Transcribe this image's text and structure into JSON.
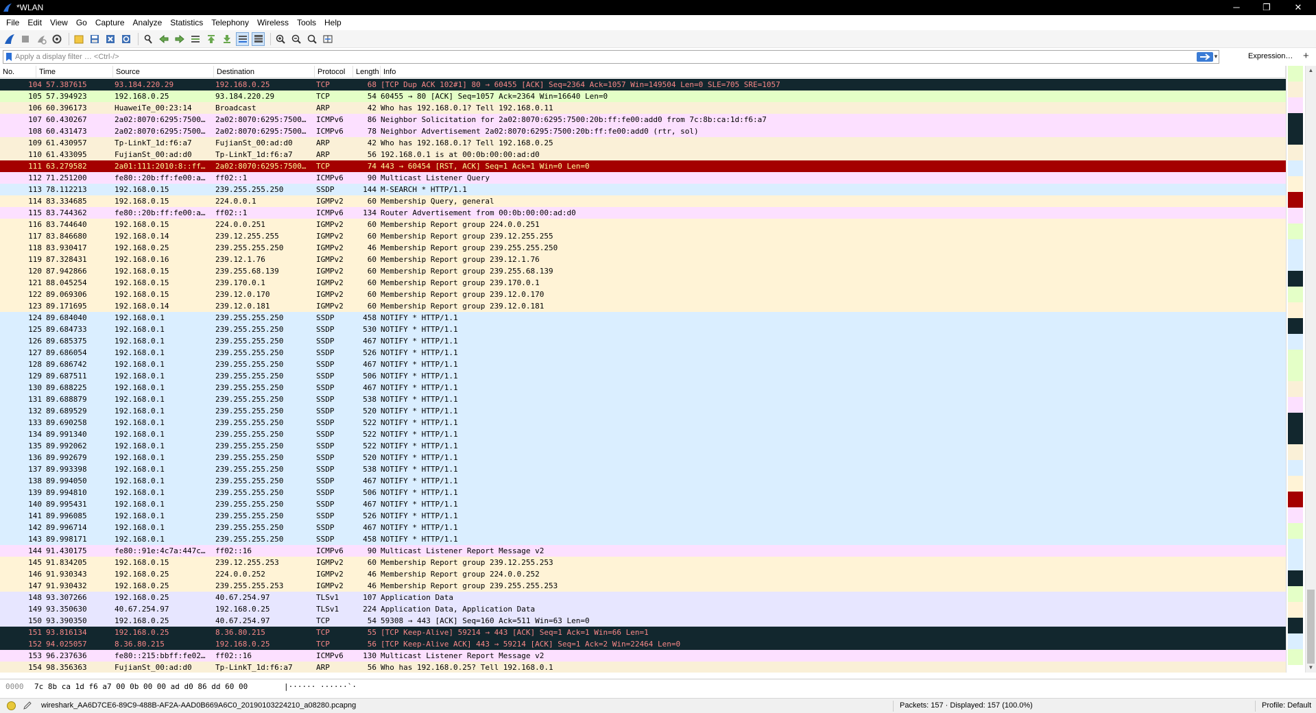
{
  "window": {
    "title": "*WLAN",
    "minimize": "─",
    "maximize": "❐",
    "close": "✕"
  },
  "menu": [
    "File",
    "Edit",
    "View",
    "Go",
    "Capture",
    "Analyze",
    "Statistics",
    "Telephony",
    "Wireless",
    "Tools",
    "Help"
  ],
  "filter": {
    "placeholder": "Apply a display filter … <Ctrl-/>",
    "value": "",
    "expression_label": "Expression…",
    "add_label": "+"
  },
  "columns": [
    "No.",
    "Time",
    "Source",
    "Destination",
    "Protocol",
    "Length",
    "Info"
  ],
  "colors": {
    "tcp": "#e7e6ff",
    "tcp_green": "#e4ffc7",
    "arp": "#faf0d7",
    "icmpv6": "#fce0ff",
    "ssdp_udp": "#daeeff",
    "igmp": "#fff3d6",
    "tls": "#e7e6ff",
    "bad_bg": "#12272e",
    "bad_fg": "#f78787",
    "rst_bg": "#a40000",
    "rst_fg": "#fffc9c",
    "selected": "#cce8ff"
  },
  "packets": [
    {
      "no": "104",
      "time": "57.387615",
      "src": "93.184.220.29",
      "dst": "192.168.0.25",
      "proto": "TCP",
      "len": "68",
      "info": "[TCP Dup ACK 102#1] 80 → 60455 [ACK] Seq=2364 Ack=1057 Win=149504 Len=0 SLE=705 SRE=1057",
      "style": "bad"
    },
    {
      "no": "105",
      "time": "57.394923",
      "src": "192.168.0.25",
      "dst": "93.184.220.29",
      "proto": "TCP",
      "len": "54",
      "info": "60455 → 80 [ACK] Seq=1057 Ack=2364 Win=16640 Len=0",
      "style": "tcp_green"
    },
    {
      "no": "106",
      "time": "60.396173",
      "src": "HuaweiTe_00:23:14",
      "dst": "Broadcast",
      "proto": "ARP",
      "len": "42",
      "info": "Who has 192.168.0.1? Tell 192.168.0.11",
      "style": "arp"
    },
    {
      "no": "107",
      "time": "60.430267",
      "src": "2a02:8070:6295:7500…",
      "dst": "2a02:8070:6295:7500…",
      "proto": "ICMPv6",
      "len": "86",
      "info": "Neighbor Solicitation for 2a02:8070:6295:7500:20b:ff:fe00:add0 from 7c:8b:ca:1d:f6:a7",
      "style": "icmpv6"
    },
    {
      "no": "108",
      "time": "60.431473",
      "src": "2a02:8070:6295:7500…",
      "dst": "2a02:8070:6295:7500…",
      "proto": "ICMPv6",
      "len": "78",
      "info": "Neighbor Advertisement 2a02:8070:6295:7500:20b:ff:fe00:add0 (rtr, sol)",
      "style": "icmpv6"
    },
    {
      "no": "109",
      "time": "61.430957",
      "src": "Tp-LinkT_1d:f6:a7",
      "dst": "FujianSt_00:ad:d0",
      "proto": "ARP",
      "len": "42",
      "info": "Who has 192.168.0.1? Tell 192.168.0.25",
      "style": "arp"
    },
    {
      "no": "110",
      "time": "61.433095",
      "src": "FujianSt_00:ad:d0",
      "dst": "Tp-LinkT_1d:f6:a7",
      "proto": "ARP",
      "len": "56",
      "info": "192.168.0.1 is at 00:0b:00:00:ad:d0",
      "style": "arp"
    },
    {
      "no": "111",
      "time": "63.279582",
      "src": "2a01:111:2010:8::ff…",
      "dst": "2a02:8070:6295:7500…",
      "proto": "TCP",
      "len": "74",
      "info": "443 → 60454 [RST, ACK] Seq=1 Ack=1 Win=0 Len=0",
      "style": "rst"
    },
    {
      "no": "112",
      "time": "71.251200",
      "src": "fe80::20b:ff:fe00:a…",
      "dst": "ff02::1",
      "proto": "ICMPv6",
      "len": "90",
      "info": "Multicast Listener Query",
      "style": "icmpv6"
    },
    {
      "no": "113",
      "time": "78.112213",
      "src": "192.168.0.15",
      "dst": "239.255.255.250",
      "proto": "SSDP",
      "len": "144",
      "info": "M-SEARCH * HTTP/1.1",
      "style": "ssdp_udp"
    },
    {
      "no": "114",
      "time": "83.334685",
      "src": "192.168.0.15",
      "dst": "224.0.0.1",
      "proto": "IGMPv2",
      "len": "60",
      "info": "Membership Query, general",
      "style": "igmp"
    },
    {
      "no": "115",
      "time": "83.744362",
      "src": "fe80::20b:ff:fe00:a…",
      "dst": "ff02::1",
      "proto": "ICMPv6",
      "len": "134",
      "info": "Router Advertisement from 00:0b:00:00:ad:d0",
      "style": "icmpv6"
    },
    {
      "no": "116",
      "time": "83.744640",
      "src": "192.168.0.15",
      "dst": "224.0.0.251",
      "proto": "IGMPv2",
      "len": "60",
      "info": "Membership Report group 224.0.0.251",
      "style": "igmp"
    },
    {
      "no": "117",
      "time": "83.846680",
      "src": "192.168.0.14",
      "dst": "239.12.255.255",
      "proto": "IGMPv2",
      "len": "60",
      "info": "Membership Report group 239.12.255.255",
      "style": "igmp"
    },
    {
      "no": "118",
      "time": "83.930417",
      "src": "192.168.0.25",
      "dst": "239.255.255.250",
      "proto": "IGMPv2",
      "len": "46",
      "info": "Membership Report group 239.255.255.250",
      "style": "igmp"
    },
    {
      "no": "119",
      "time": "87.328431",
      "src": "192.168.0.16",
      "dst": "239.12.1.76",
      "proto": "IGMPv2",
      "len": "60",
      "info": "Membership Report group 239.12.1.76",
      "style": "igmp"
    },
    {
      "no": "120",
      "time": "87.942866",
      "src": "192.168.0.15",
      "dst": "239.255.68.139",
      "proto": "IGMPv2",
      "len": "60",
      "info": "Membership Report group 239.255.68.139",
      "style": "igmp"
    },
    {
      "no": "121",
      "time": "88.045254",
      "src": "192.168.0.15",
      "dst": "239.170.0.1",
      "proto": "IGMPv2",
      "len": "60",
      "info": "Membership Report group 239.170.0.1",
      "style": "igmp"
    },
    {
      "no": "122",
      "time": "89.069306",
      "src": "192.168.0.15",
      "dst": "239.12.0.170",
      "proto": "IGMPv2",
      "len": "60",
      "info": "Membership Report group 239.12.0.170",
      "style": "igmp"
    },
    {
      "no": "123",
      "time": "89.171695",
      "src": "192.168.0.14",
      "dst": "239.12.0.181",
      "proto": "IGMPv2",
      "len": "60",
      "info": "Membership Report group 239.12.0.181",
      "style": "igmp"
    },
    {
      "no": "124",
      "time": "89.684040",
      "src": "192.168.0.1",
      "dst": "239.255.255.250",
      "proto": "SSDP",
      "len": "458",
      "info": "NOTIFY * HTTP/1.1",
      "style": "ssdp_udp"
    },
    {
      "no": "125",
      "time": "89.684733",
      "src": "192.168.0.1",
      "dst": "239.255.255.250",
      "proto": "SSDP",
      "len": "530",
      "info": "NOTIFY * HTTP/1.1",
      "style": "ssdp_udp"
    },
    {
      "no": "126",
      "time": "89.685375",
      "src": "192.168.0.1",
      "dst": "239.255.255.250",
      "proto": "SSDP",
      "len": "467",
      "info": "NOTIFY * HTTP/1.1",
      "style": "ssdp_udp"
    },
    {
      "no": "127",
      "time": "89.686054",
      "src": "192.168.0.1",
      "dst": "239.255.255.250",
      "proto": "SSDP",
      "len": "526",
      "info": "NOTIFY * HTTP/1.1",
      "style": "ssdp_udp"
    },
    {
      "no": "128",
      "time": "89.686742",
      "src": "192.168.0.1",
      "dst": "239.255.255.250",
      "proto": "SSDP",
      "len": "467",
      "info": "NOTIFY * HTTP/1.1",
      "style": "ssdp_udp"
    },
    {
      "no": "129",
      "time": "89.687511",
      "src": "192.168.0.1",
      "dst": "239.255.255.250",
      "proto": "SSDP",
      "len": "506",
      "info": "NOTIFY * HTTP/1.1",
      "style": "ssdp_udp"
    },
    {
      "no": "130",
      "time": "89.688225",
      "src": "192.168.0.1",
      "dst": "239.255.255.250",
      "proto": "SSDP",
      "len": "467",
      "info": "NOTIFY * HTTP/1.1",
      "style": "ssdp_udp"
    },
    {
      "no": "131",
      "time": "89.688879",
      "src": "192.168.0.1",
      "dst": "239.255.255.250",
      "proto": "SSDP",
      "len": "538",
      "info": "NOTIFY * HTTP/1.1",
      "style": "ssdp_udp"
    },
    {
      "no": "132",
      "time": "89.689529",
      "src": "192.168.0.1",
      "dst": "239.255.255.250",
      "proto": "SSDP",
      "len": "520",
      "info": "NOTIFY * HTTP/1.1",
      "style": "ssdp_udp"
    },
    {
      "no": "133",
      "time": "89.690258",
      "src": "192.168.0.1",
      "dst": "239.255.255.250",
      "proto": "SSDP",
      "len": "522",
      "info": "NOTIFY * HTTP/1.1",
      "style": "ssdp_udp"
    },
    {
      "no": "134",
      "time": "89.991340",
      "src": "192.168.0.1",
      "dst": "239.255.255.250",
      "proto": "SSDP",
      "len": "522",
      "info": "NOTIFY * HTTP/1.1",
      "style": "ssdp_udp"
    },
    {
      "no": "135",
      "time": "89.992062",
      "src": "192.168.0.1",
      "dst": "239.255.255.250",
      "proto": "SSDP",
      "len": "522",
      "info": "NOTIFY * HTTP/1.1",
      "style": "ssdp_udp"
    },
    {
      "no": "136",
      "time": "89.992679",
      "src": "192.168.0.1",
      "dst": "239.255.255.250",
      "proto": "SSDP",
      "len": "520",
      "info": "NOTIFY * HTTP/1.1",
      "style": "ssdp_udp"
    },
    {
      "no": "137",
      "time": "89.993398",
      "src": "192.168.0.1",
      "dst": "239.255.255.250",
      "proto": "SSDP",
      "len": "538",
      "info": "NOTIFY * HTTP/1.1",
      "style": "ssdp_udp"
    },
    {
      "no": "138",
      "time": "89.994050",
      "src": "192.168.0.1",
      "dst": "239.255.255.250",
      "proto": "SSDP",
      "len": "467",
      "info": "NOTIFY * HTTP/1.1",
      "style": "ssdp_udp"
    },
    {
      "no": "139",
      "time": "89.994810",
      "src": "192.168.0.1",
      "dst": "239.255.255.250",
      "proto": "SSDP",
      "len": "506",
      "info": "NOTIFY * HTTP/1.1",
      "style": "ssdp_udp"
    },
    {
      "no": "140",
      "time": "89.995431",
      "src": "192.168.0.1",
      "dst": "239.255.255.250",
      "proto": "SSDP",
      "len": "467",
      "info": "NOTIFY * HTTP/1.1",
      "style": "ssdp_udp"
    },
    {
      "no": "141",
      "time": "89.996085",
      "src": "192.168.0.1",
      "dst": "239.255.255.250",
      "proto": "SSDP",
      "len": "526",
      "info": "NOTIFY * HTTP/1.1",
      "style": "ssdp_udp"
    },
    {
      "no": "142",
      "time": "89.996714",
      "src": "192.168.0.1",
      "dst": "239.255.255.250",
      "proto": "SSDP",
      "len": "467",
      "info": "NOTIFY * HTTP/1.1",
      "style": "ssdp_udp"
    },
    {
      "no": "143",
      "time": "89.998171",
      "src": "192.168.0.1",
      "dst": "239.255.255.250",
      "proto": "SSDP",
      "len": "458",
      "info": "NOTIFY * HTTP/1.1",
      "style": "ssdp_udp"
    },
    {
      "no": "144",
      "time": "91.430175",
      "src": "fe80::91e:4c7a:447c…",
      "dst": "ff02::16",
      "proto": "ICMPv6",
      "len": "90",
      "info": "Multicast Listener Report Message v2",
      "style": "icmpv6"
    },
    {
      "no": "145",
      "time": "91.834205",
      "src": "192.168.0.15",
      "dst": "239.12.255.253",
      "proto": "IGMPv2",
      "len": "60",
      "info": "Membership Report group 239.12.255.253",
      "style": "igmp"
    },
    {
      "no": "146",
      "time": "91.930343",
      "src": "192.168.0.25",
      "dst": "224.0.0.252",
      "proto": "IGMPv2",
      "len": "46",
      "info": "Membership Report group 224.0.0.252",
      "style": "igmp"
    },
    {
      "no": "147",
      "time": "91.930432",
      "src": "192.168.0.25",
      "dst": "239.255.255.253",
      "proto": "IGMPv2",
      "len": "46",
      "info": "Membership Report group 239.255.255.253",
      "style": "igmp"
    },
    {
      "no": "148",
      "time": "93.307266",
      "src": "192.168.0.25",
      "dst": "40.67.254.97",
      "proto": "TLSv1",
      "len": "107",
      "info": "Application Data",
      "style": "tls"
    },
    {
      "no": "149",
      "time": "93.350630",
      "src": "40.67.254.97",
      "dst": "192.168.0.25",
      "proto": "TLSv1",
      "len": "224",
      "info": "Application Data, Application Data",
      "style": "tls"
    },
    {
      "no": "150",
      "time": "93.390350",
      "src": "192.168.0.25",
      "dst": "40.67.254.97",
      "proto": "TCP",
      "len": "54",
      "info": "59308 → 443 [ACK] Seq=160 Ack=511 Win=63 Len=0",
      "style": "tcp"
    },
    {
      "no": "151",
      "time": "93.816134",
      "src": "192.168.0.25",
      "dst": "8.36.80.215",
      "proto": "TCP",
      "len": "55",
      "info": "[TCP Keep-Alive] 59214 → 443 [ACK] Seq=1 Ack=1 Win=66 Len=1",
      "style": "bad"
    },
    {
      "no": "152",
      "time": "94.025057",
      "src": "8.36.80.215",
      "dst": "192.168.0.25",
      "proto": "TCP",
      "len": "56",
      "info": "[TCP Keep-Alive ACK] 443 → 59214 [ACK] Seq=1 Ack=2 Win=22464 Len=0",
      "style": "bad"
    },
    {
      "no": "153",
      "time": "96.237636",
      "src": "fe80::215:bbff:fe02…",
      "dst": "ff02::16",
      "proto": "ICMPv6",
      "len": "130",
      "info": "Multicast Listener Report Message v2",
      "style": "icmpv6"
    },
    {
      "no": "154",
      "time": "98.356363",
      "src": "FujianSt_00:ad:d0",
      "dst": "Tp-LinkT_1d:f6:a7",
      "proto": "ARP",
      "len": "56",
      "info": "Who has 192.168.0.25? Tell 192.168.0.1",
      "style": "arp"
    }
  ],
  "bytes_pane": {
    "offset": "0000",
    "hex": "7c 8b ca 1d f6 a7 00 0b  00 00 ad d0 86 dd 60 00",
    "ascii": "|······ ······`·"
  },
  "status": {
    "file": "wireshark_AA6D7CE6-89C9-488B-AF2A-AAD0B669A6C0_20190103224210_a08280.pcapng",
    "packets": "Packets: 157 · Displayed: 157 (100.0%)",
    "profile": "Profile: Default"
  },
  "icons": [
    "shark-fin-icon",
    "stop-icon",
    "restart-icon",
    "options-icon",
    "open-folder-icon",
    "save-icon",
    "close-file-icon",
    "reload-icon",
    "find-icon",
    "back-icon",
    "forward-icon",
    "goto-icon",
    "first-icon",
    "last-icon",
    "autoscroll-icon",
    "colorize-icon",
    "zoom-in-icon",
    "zoom-out-icon",
    "zoom-normal-icon",
    "resize-columns-icon"
  ]
}
